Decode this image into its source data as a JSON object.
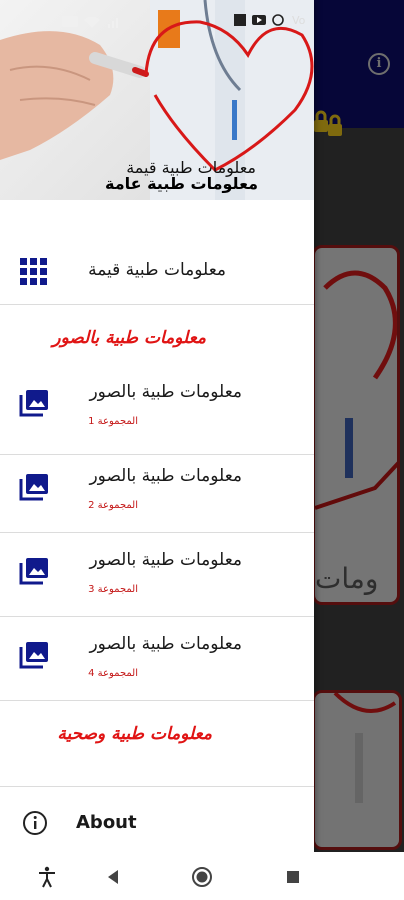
{
  "status_bar": {
    "time": "",
    "language_indicator": "Vo"
  },
  "header": {
    "title_line1": "معلومات طبية قيمة",
    "title_line2": "معلومات طبية عامة",
    "image_icon": "doctor-writing-heart-image"
  },
  "drawer": {
    "top_item": {
      "label": "معلومات طبية قيمة",
      "icon": "grid-icon"
    },
    "section_images": {
      "title": "معلومات طبية بالصور"
    },
    "image_items": [
      {
        "label": "معلومات طبية بالصور",
        "sublabel": "المجموعة 1",
        "icon": "photo-library-icon"
      },
      {
        "label": "معلومات طبية بالصور",
        "sublabel": "المجموعة 2",
        "icon": "photo-library-icon"
      },
      {
        "label": "معلومات طبية بالصور",
        "sublabel": "المجموعة 3",
        "icon": "photo-library-icon"
      },
      {
        "label": "معلومات طبية بالصور",
        "sublabel": "المجموعة 4",
        "icon": "photo-library-icon"
      }
    ],
    "section_health": {
      "title": "معلومات طبية وصحية"
    },
    "about_item": {
      "label": "About",
      "icon": "info-icon"
    }
  },
  "background_app": {
    "toolbar_color": "#0b0b66",
    "info_icon_glyph": "i"
  },
  "nav_bar": {
    "buttons": [
      "accessibility-icon",
      "back-icon",
      "home-icon",
      "recents-icon"
    ]
  },
  "colors": {
    "accent_red": "#e01414",
    "sublabel_red": "#c41717",
    "icon_blue": "#101a8c",
    "toolbar_navy": "#0b0b66"
  }
}
